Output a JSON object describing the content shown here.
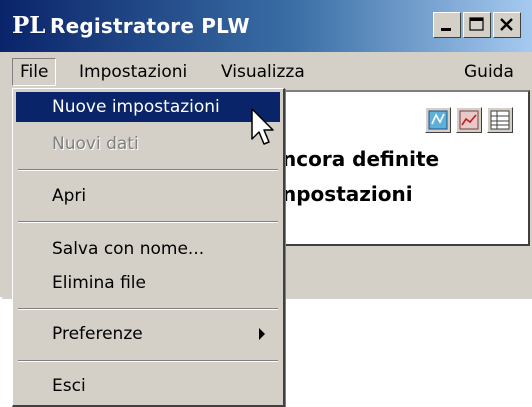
{
  "window": {
    "title": "Registratore PLW",
    "logo_text": "PL",
    "controls": {
      "minimize_icon": "minimize-icon",
      "maximize_icon": "maximize-icon",
      "close_icon": "close-icon"
    }
  },
  "menubar": {
    "file": "File",
    "impostazioni": "Impostazioni",
    "visualizza": "Visualizza",
    "guida": "Guida"
  },
  "panel": {
    "message_line1": "ncora definite",
    "message_line2": "npostazioni",
    "view_buttons": [
      {
        "icon": "scope-view-icon"
      },
      {
        "icon": "chart-view-icon"
      },
      {
        "icon": "table-view-icon"
      }
    ]
  },
  "file_menu": {
    "items": [
      {
        "label": "Nuove impostazioni",
        "state": "highlighted"
      },
      {
        "label": "Nuovi dati",
        "state": "disabled"
      },
      {
        "label": "Apri",
        "state": "normal"
      },
      {
        "label": "Salva con nome...",
        "state": "normal"
      },
      {
        "label": "Elimina file",
        "state": "normal"
      },
      {
        "label": "Preferenze",
        "state": "submenu"
      },
      {
        "label": "Esci",
        "state": "normal"
      }
    ]
  },
  "colors": {
    "titlebar_start": "#0a246a",
    "titlebar_end": "#a6caf0",
    "menu_highlight": "#0a246a",
    "face": "#d4d0c8"
  }
}
